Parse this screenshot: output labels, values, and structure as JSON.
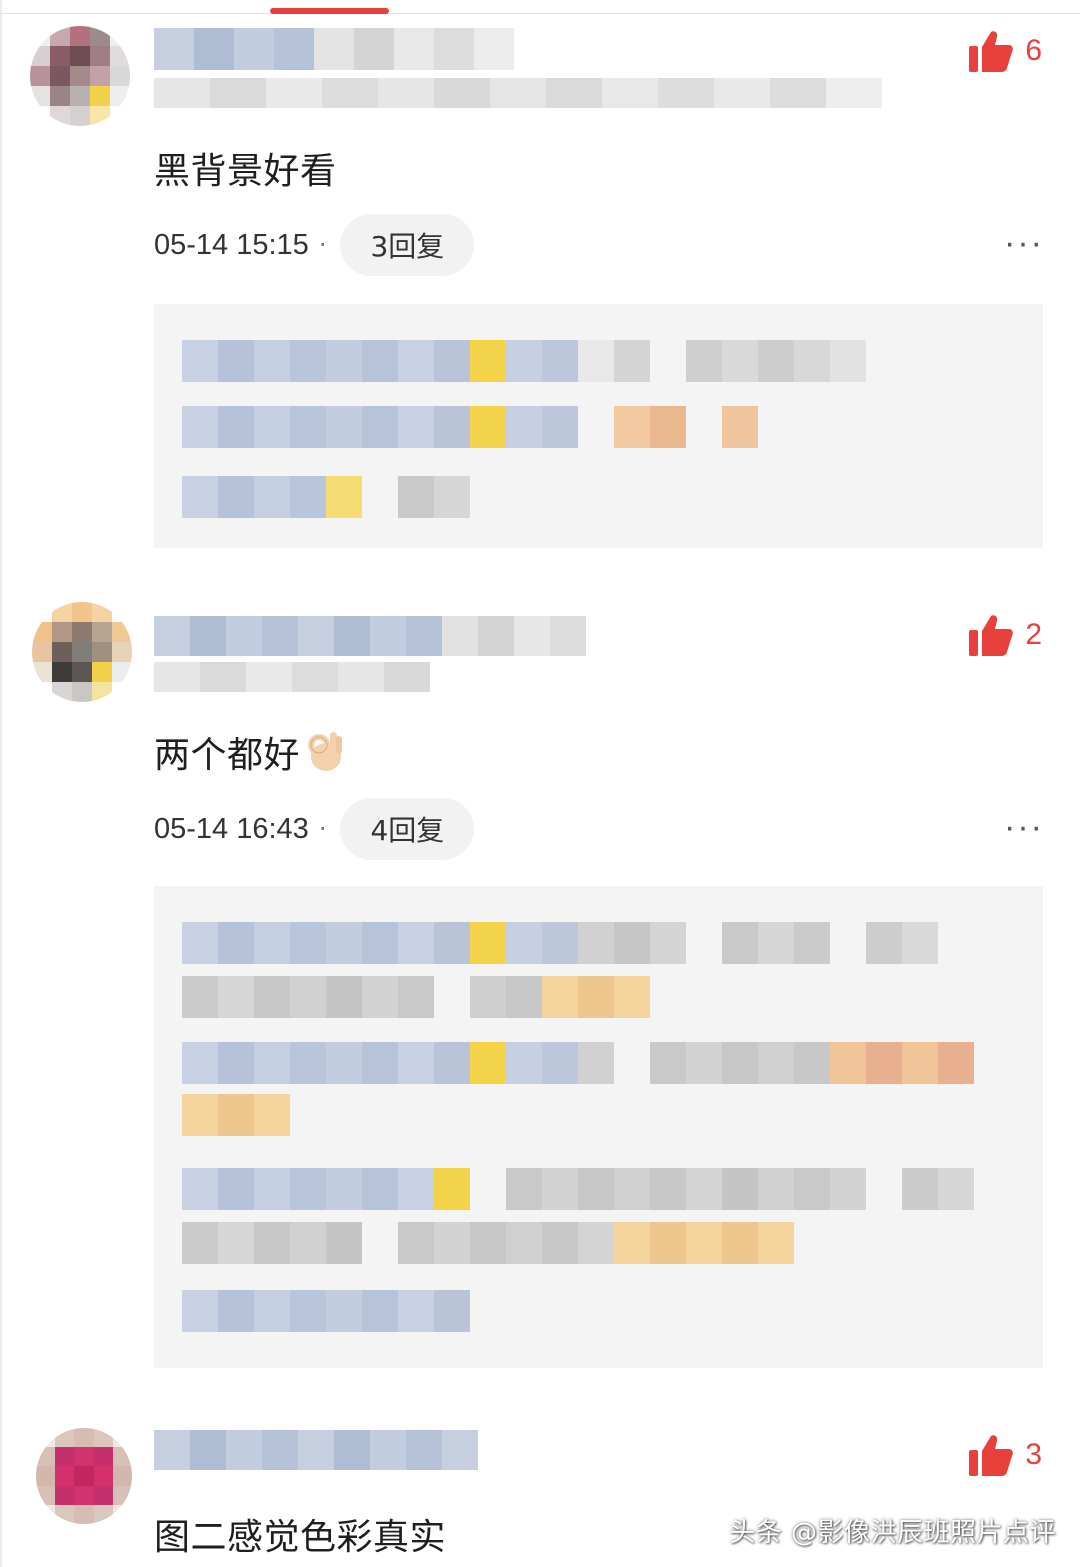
{
  "colors": {
    "accent": "#e8403b",
    "reply_box_bg": "#f4f4f4",
    "reply_pill_bg": "#f2f2f2"
  },
  "comments": [
    {
      "text": "黑背景好看",
      "likes": "6",
      "time": "05-14 15:15",
      "separator": "·",
      "reply_label": "3回复",
      "more_label": "···"
    },
    {
      "text": "两个都好",
      "likes": "2",
      "time": "05-14 16:43",
      "separator": "·",
      "reply_label": "4回复",
      "more_label": "···"
    },
    {
      "text": "图二感觉色彩真实",
      "likes": "3"
    }
  ],
  "icons": {
    "like": "thumbs-up-icon",
    "more": "more-dots-icon",
    "emoji": "ok-hand-emoji-icon"
  },
  "watermark": "头条 @影像洪辰班照片点评"
}
